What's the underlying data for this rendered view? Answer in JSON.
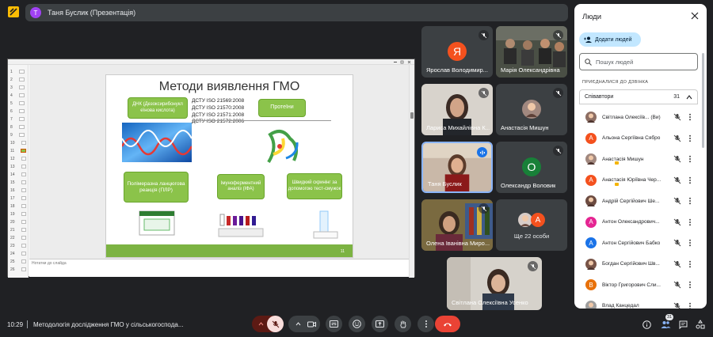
{
  "presenter_chip": {
    "avatar_letter": "Т",
    "label": "Таня Буслик (Презентація)"
  },
  "slide": {
    "title": "Методи виявлення ГМО",
    "dna_box": "ДНК (Дезоксирибонукл еїнова кислота)",
    "standards": [
      "ДСТУ ISO 21569:2008",
      "ДСТУ ISO 21570:2008",
      "ДСТУ ISO 21571:2008",
      "ДСТУ ISO 21572:2006"
    ],
    "protein_box": "Протеїни",
    "pcr_box": "Полімеразна ланцюгова реакція (ПЛР)",
    "elisa_box": "Імуноферментний аналіз (ІФА)",
    "strip_box": "Швидкий скринінг за допомогою тест-смужок",
    "page_number": "11"
  },
  "powerpoint": {
    "notes_placeholder": "Нотатки до слайда",
    "thumbnails": [
      "1",
      "2",
      "3",
      "4",
      "5",
      "6",
      "7",
      "8",
      "9",
      "10",
      "11",
      "12",
      "13",
      "14",
      "15",
      "16",
      "17",
      "18",
      "19",
      "20",
      "21",
      "22",
      "23",
      "24",
      "25",
      "26"
    ]
  },
  "tiles": [
    {
      "name": "Ярослав Володимир...",
      "avatar": "Я",
      "color": "#f4511e"
    },
    {
      "name": "Марія Олександрівна",
      "avatar": "",
      "color": ""
    },
    {
      "name": "Лариса Михайлівна К...",
      "avatar": "",
      "color": ""
    },
    {
      "name": "Анастасія Мишун",
      "avatar": "",
      "color": ""
    },
    {
      "name": "Таня Буслик",
      "avatar": "",
      "color": ""
    },
    {
      "name": "Олександр Воловик",
      "avatar": "О",
      "color": "#188038"
    },
    {
      "name": "Олена Іванівна Миро...",
      "avatar": "",
      "color": ""
    },
    {
      "name": "Ще 22 особи",
      "avatar": "А",
      "color": "#f4511e"
    },
    {
      "name": "Світлана Олексіївна Усенко",
      "avatar": "",
      "color": ""
    }
  ],
  "panel": {
    "title": "Люди",
    "add_label": "Додати людей",
    "search_placeholder": "Пошук людей",
    "section_label": "ПРИЄДНАЛИСЯ ДО ДЗВІНКА",
    "group_label": "Співавтори",
    "group_count": "31",
    "people": [
      {
        "name": "Світлана Олексіїв... (Ви)",
        "letter": "",
        "color": "#8d6e63"
      },
      {
        "name": "Альона Сергіївна Сябро",
        "letter": "А",
        "color": "#f4511e"
      },
      {
        "name": "Анастасія Мишун",
        "letter": "",
        "color": "#a1887f"
      },
      {
        "name": "Анастасія Юріївна Чер...",
        "letter": "А",
        "color": "#f4511e"
      },
      {
        "name": "Андрій Сергійович Ше...",
        "letter": "",
        "color": "#6d4c41"
      },
      {
        "name": "Антон Олександрович...",
        "letter": "А",
        "color": "#e52592"
      },
      {
        "name": "Антон Сергійович Бабко",
        "letter": "А",
        "color": "#1a73e8"
      },
      {
        "name": "Богдан Сергійович Шв...",
        "letter": "",
        "color": "#795548"
      },
      {
        "name": "Віктор Григорович Сли...",
        "letter": "В",
        "color": "#e8710a"
      },
      {
        "name": "Влад Канцедал",
        "letter": "",
        "color": "#9e9e9e"
      }
    ]
  },
  "bottom": {
    "time": "10:29",
    "meeting_title": "Методологія дослідження ГМО у сільськогоспода...",
    "people_count": "31"
  },
  "colors": {
    "accent_red": "#ea4335",
    "mic_off_bg": "#f9dedc",
    "panel_blue": "#c2e7ff",
    "slide_green": "#8bc34a"
  }
}
